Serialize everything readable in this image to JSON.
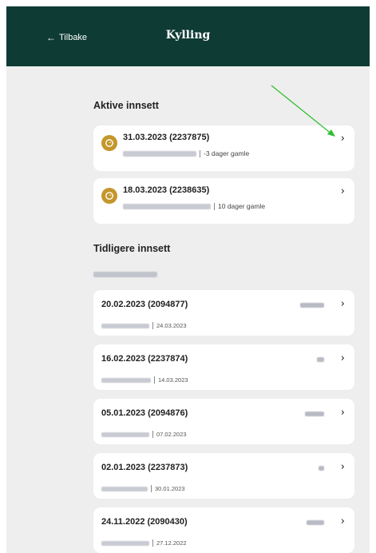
{
  "header": {
    "back_label": "Tilbake",
    "back_arrow": "←",
    "title": "Kylling",
    "background": "#0e3b34"
  },
  "active": {
    "title": "Aktive innsett",
    "items": [
      {
        "date": "31.03.2023 (2237875)",
        "age": "-3 dager gamle",
        "icon": "chick-icon"
      },
      {
        "date": "18.03.2023 (2238635)",
        "age": "10 dager gamle",
        "icon": "chick-icon"
      }
    ]
  },
  "previous": {
    "title": "Tidligere innsett",
    "items": [
      {
        "date": "20.02.2023 (2094877)",
        "end_date": "24.03.2023"
      },
      {
        "date": "16.02.2023 (2237874)",
        "end_date": "14.03.2023"
      },
      {
        "date": "05.01.2023 (2094876)",
        "end_date": "07.02.2023"
      },
      {
        "date": "02.01.2023 (2237873)",
        "end_date": "30.01.2023"
      },
      {
        "date": "24.11.2022 (2090430)",
        "end_date": "27.12.2022"
      }
    ]
  },
  "chevron": "›",
  "colors": {
    "accent": "#c4962b",
    "annotation_arrow": "#2fbf2f",
    "background": "#eeeeee"
  }
}
